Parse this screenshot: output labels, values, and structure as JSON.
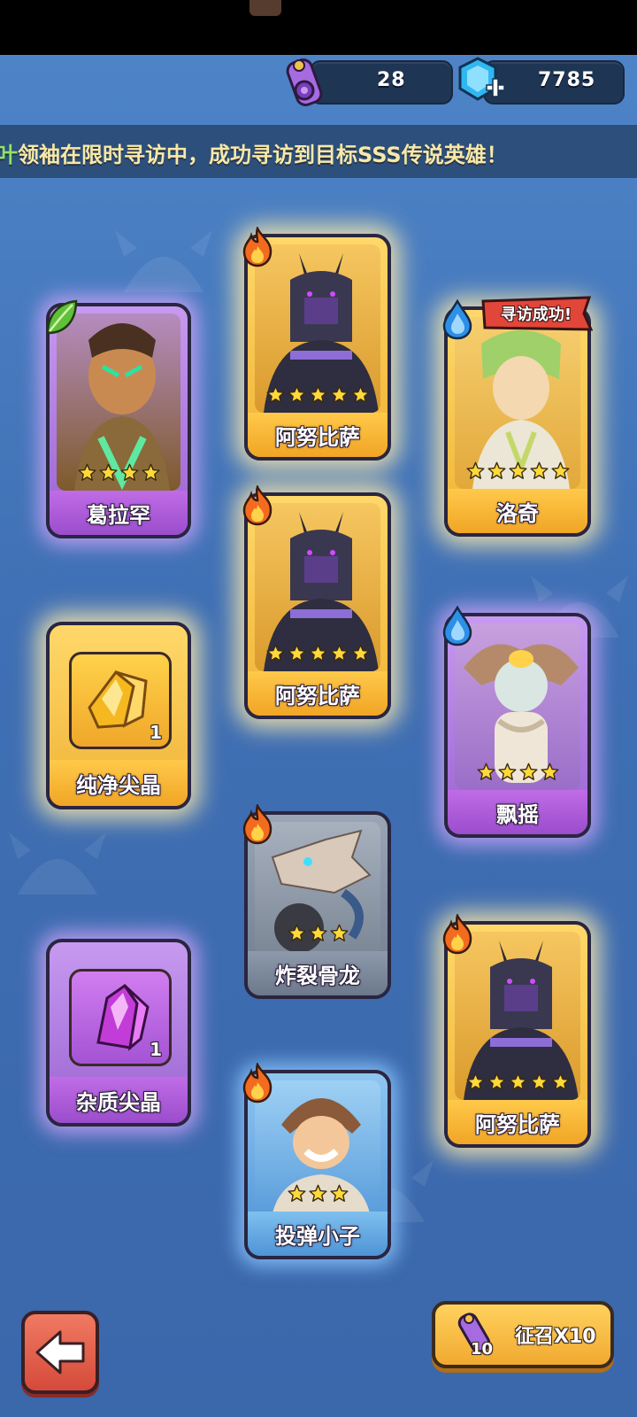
{
  "resources": {
    "scrolls": "28",
    "gems": "7785"
  },
  "announcement": {
    "highlight": "叶",
    "text": "领袖在限时寻访中，成功寻访到目标SSS传说英雄！"
  },
  "cards": [
    {
      "id": "c1",
      "name": "葛拉罕",
      "stars": 4,
      "element": "leaf-icon",
      "rarity": "purple"
    },
    {
      "id": "c2",
      "name": "阿努比萨",
      "stars": 5,
      "element": "fire-icon",
      "rarity": "gold"
    },
    {
      "id": "c3",
      "name": "洛奇",
      "stars": 5,
      "element": "water-icon",
      "rarity": "gold",
      "tag": "寻访成功!"
    },
    {
      "id": "c4",
      "name": "阿努比萨",
      "stars": 5,
      "element": "fire-icon",
      "rarity": "gold"
    },
    {
      "id": "c5",
      "name": "纯净尖晶",
      "count": "1",
      "rarity": "gold",
      "kind": "item",
      "icon": "golden-crystal-icon"
    },
    {
      "id": "c6",
      "name": "飘摇",
      "stars": 4,
      "element": "water-icon",
      "rarity": "purple"
    },
    {
      "id": "c7",
      "name": "炸裂骨龙",
      "stars": 3,
      "element": "fire-icon",
      "rarity": "grey"
    },
    {
      "id": "c8",
      "name": "杂质尖晶",
      "count": "1",
      "rarity": "purple",
      "kind": "item",
      "icon": "purple-crystal-icon"
    },
    {
      "id": "c9",
      "name": "阿努比萨",
      "stars": 5,
      "element": "fire-icon",
      "rarity": "gold"
    },
    {
      "id": "c10",
      "name": "投弹小子",
      "stars": 3,
      "element": "fire-icon",
      "rarity": "blue"
    }
  ],
  "buttons": {
    "back": "back-arrow-icon",
    "summon_label": "征召X10",
    "summon_count": "10"
  },
  "colors": {
    "background": "#4f86c9",
    "gold": "#f1a525",
    "purple": "#9b4dcc",
    "blue": "#4f94d6",
    "banner_text": "#f6e9a8",
    "banner_highlight": "#8fe36a"
  }
}
